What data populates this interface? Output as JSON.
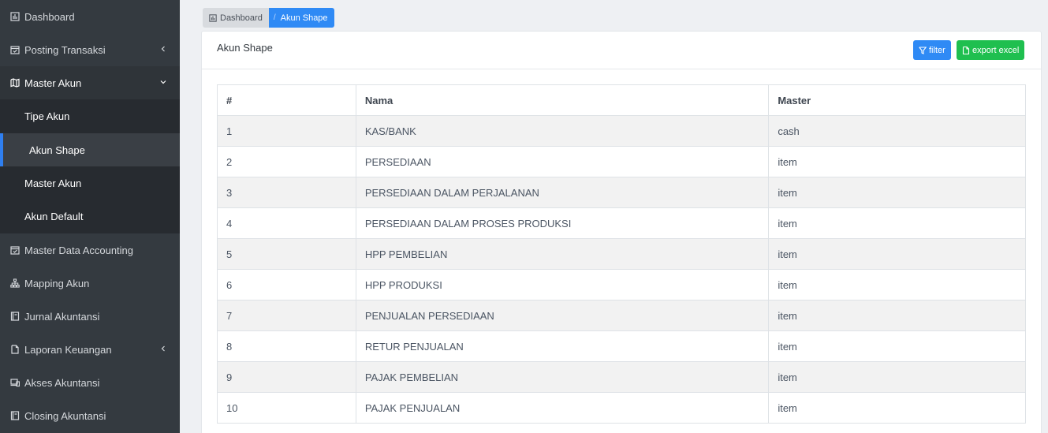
{
  "sidebar": {
    "items": [
      {
        "label": "Dashboard",
        "icon": "bar-chart-icon"
      },
      {
        "label": "Posting Transaksi",
        "icon": "calendar-check-icon"
      },
      {
        "label": "Master Akun",
        "icon": "map-icon"
      },
      {
        "label": "Master Data Accounting",
        "icon": "calendar-check-icon"
      },
      {
        "label": "Mapping Akun",
        "icon": "sitemap-icon"
      },
      {
        "label": "Jurnal Akuntansi",
        "icon": "book-icon"
      },
      {
        "label": "Laporan Keuangan",
        "icon": "file-icon"
      },
      {
        "label": "Akses Akuntansi",
        "icon": "devices-icon"
      },
      {
        "label": "Closing Akuntansi",
        "icon": "book-icon"
      }
    ],
    "submenu": [
      {
        "label": "Tipe Akun"
      },
      {
        "label": "Akun Shape"
      },
      {
        "label": "Master Akun"
      },
      {
        "label": "Akun Default"
      }
    ]
  },
  "breadcrumb": {
    "home": "Dashboard",
    "current": "Akun Shape"
  },
  "card": {
    "title": "Akun Shape",
    "filter_label": "filter",
    "export_label": "export excel"
  },
  "table": {
    "headers": [
      "#",
      "Nama",
      "Master"
    ],
    "rows": [
      [
        "1",
        "KAS/BANK",
        "cash"
      ],
      [
        "2",
        "PERSEDIAAN",
        "item"
      ],
      [
        "3",
        "PERSEDIAAN DALAM PERJALANAN",
        "item"
      ],
      [
        "4",
        "PERSEDIAAN DALAM PROSES PRODUKSI",
        "item"
      ],
      [
        "5",
        "HPP PEMBELIAN",
        "item"
      ],
      [
        "6",
        "HPP PRODUKSI",
        "item"
      ],
      [
        "7",
        "PENJUALAN PERSEDIAAN",
        "item"
      ],
      [
        "8",
        "RETUR PENJUALAN",
        "item"
      ],
      [
        "9",
        "PAJAK PEMBELIAN",
        "item"
      ],
      [
        "10",
        "PAJAK PENJUALAN",
        "item"
      ]
    ]
  },
  "colors": {
    "sidebar_bg": "#343a40",
    "submenu_bg": "#272b30",
    "active_indicator": "#2f7ff0",
    "primary": "#2f8af5",
    "success": "#1fbf4f"
  }
}
